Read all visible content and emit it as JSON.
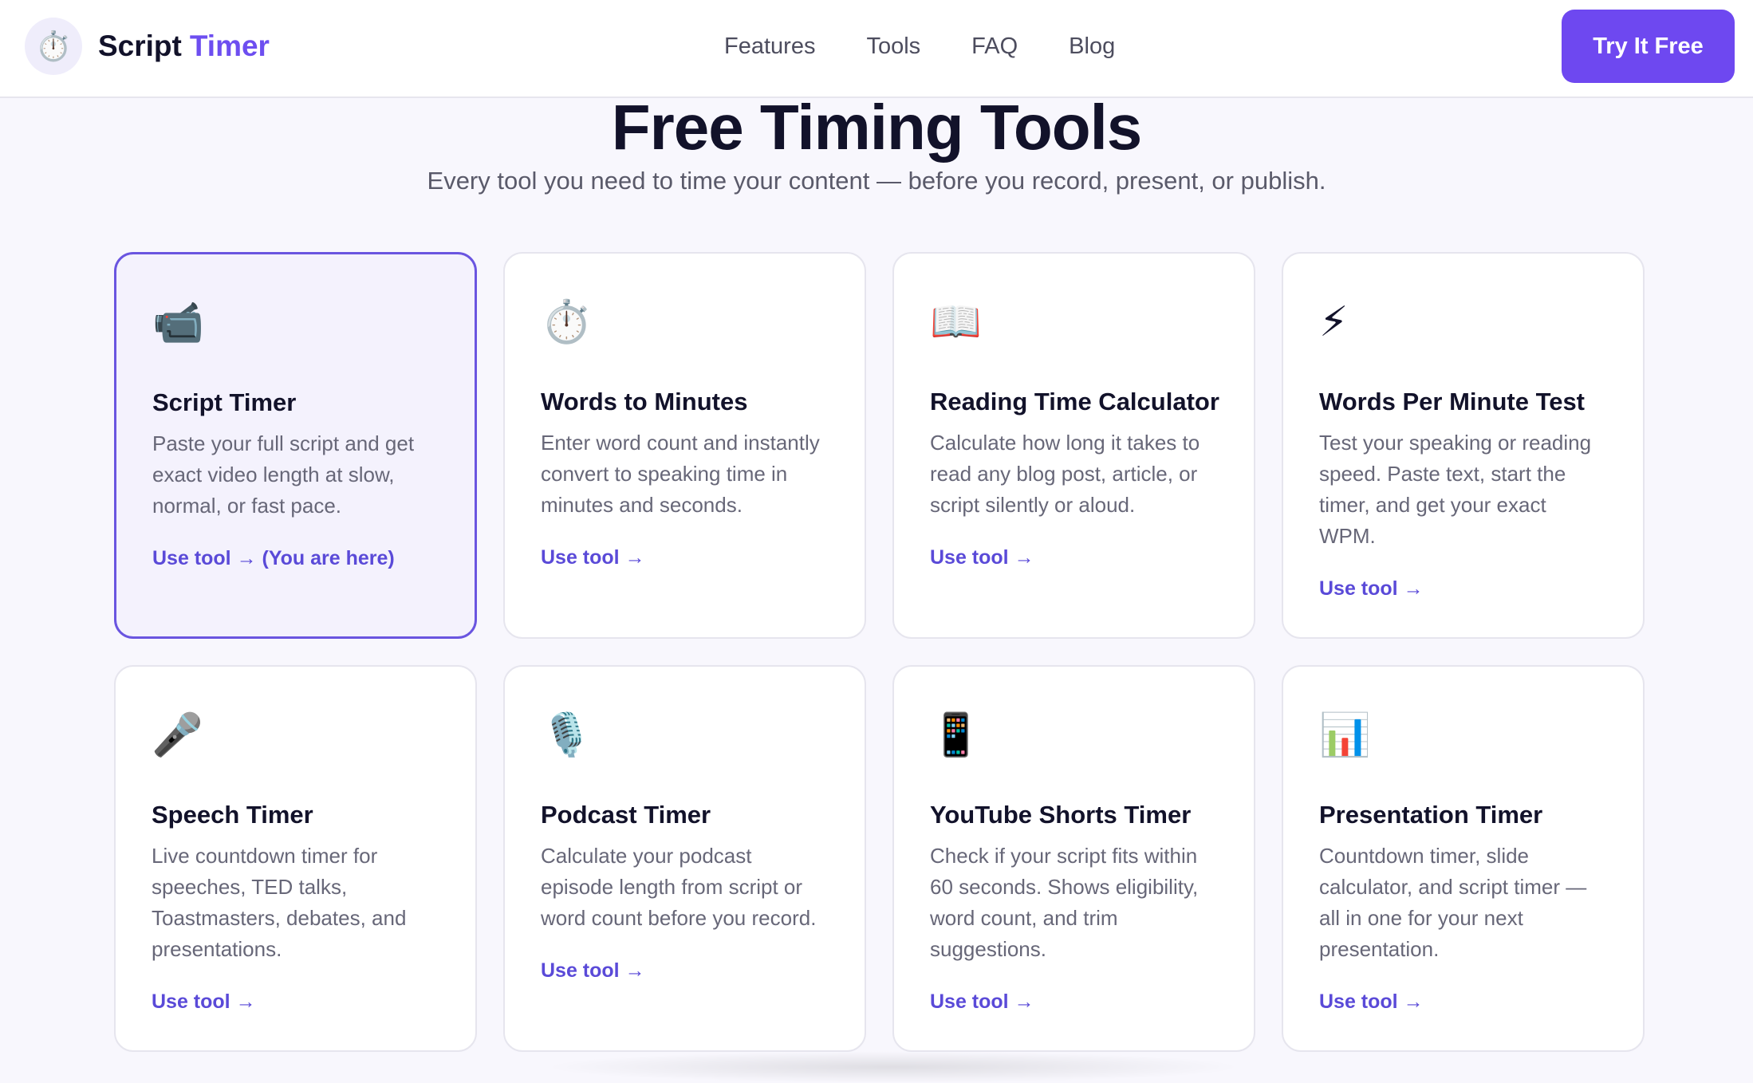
{
  "brand": {
    "icon": "stopwatch-icon",
    "icon_glyph": "⏱️",
    "name_part1": "Script",
    "name_part2": "Timer",
    "accent_color": "#6e48f0"
  },
  "nav": {
    "links": [
      "Features",
      "Tools",
      "FAQ",
      "Blog"
    ],
    "cta_label": "Try It Free"
  },
  "hero": {
    "title": "Free Timing Tools",
    "subtitle": "Every tool you need to time your content — before you record, present, or publish."
  },
  "tools": [
    {
      "icon": "video-camera-icon",
      "icon_glyph": "📹",
      "title": "Script Timer",
      "description": "Paste your full script and get exact video length at slow, normal, or fast pace.",
      "link": "Use tool → (You are here)",
      "active": true
    },
    {
      "icon": "stopwatch-icon",
      "icon_glyph": "⏱️",
      "title": "Words to Minutes",
      "description": "Enter word count and instantly convert to speaking time in minutes and seconds.",
      "link": "Use tool →",
      "active": false
    },
    {
      "icon": "open-book-icon",
      "icon_glyph": "📖",
      "title": "Reading Time Calculator",
      "description": "Calculate how long it takes to read any blog post, article, or script silently or aloud.",
      "link": "Use tool →",
      "active": false
    },
    {
      "icon": "lightning-icon",
      "icon_glyph": "⚡",
      "title": "Words Per Minute Test",
      "description": "Test your speaking or reading speed. Paste text, start the timer, and get your exact WPM.",
      "link": "Use tool →",
      "active": false
    },
    {
      "icon": "microphone-icon",
      "icon_glyph": "🎤",
      "title": "Speech Timer",
      "description": "Live countdown timer for speeches, TED talks, Toastmasters, debates, and presentations.",
      "link": "Use tool →",
      "active": false
    },
    {
      "icon": "studio-microphone-icon",
      "icon_glyph": "🎙️",
      "title": "Podcast Timer",
      "description": "Calculate your podcast episode length from script or word count before you record.",
      "link": "Use tool →",
      "active": false
    },
    {
      "icon": "mobile-phone-icon",
      "icon_glyph": "📱",
      "title": "YouTube Shorts Timer",
      "description": "Check if your script fits within 60 seconds. Shows eligibility, word count, and trim suggestions.",
      "link": "Use tool →",
      "active": false
    },
    {
      "icon": "bar-chart-icon",
      "icon_glyph": "📊",
      "title": "Presentation Timer",
      "description": "Countdown timer, slide calculator, and script timer — all in one for your next presentation.",
      "link": "Use tool →",
      "active": false
    }
  ]
}
